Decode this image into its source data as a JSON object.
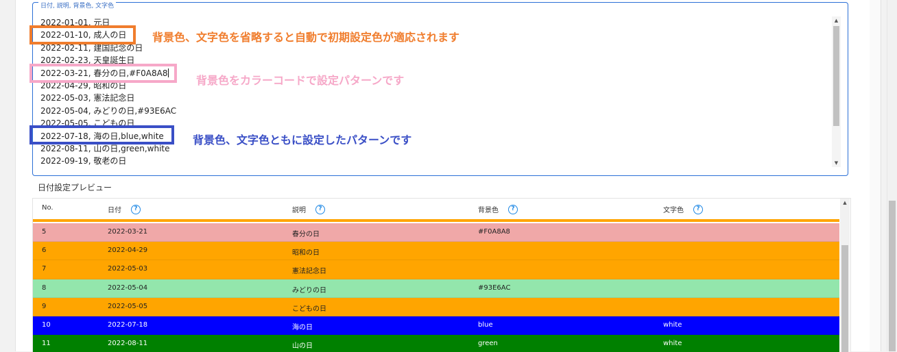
{
  "date_box": {
    "legend": "日付, 説明, 背景色, 文字色",
    "lines": [
      "2022-01-01, 元日",
      "2022-01-10, 成人の日",
      "2022-02-11, 建国記念の日",
      "2022-02-23, 天皇誕生日",
      "2022-03-21, 春分の日,#F0A8A8",
      "2022-04-29, 昭和の日",
      "2022-05-03, 憲法記念日",
      "2022-05-04, みどりの日,#93E6AC",
      "2022-05-05, こどもの日",
      "2022-07-18, 海の日,blue,white",
      "2022-08-11, 山の日,green,white",
      "2022-09-19, 敬老の日"
    ]
  },
  "annotations": {
    "orange": "背景色、文字色を省略すると自動で初期設定色が適応されます",
    "pink": "背景色をカラーコードで設定パターンです",
    "blue": "背景色、文字色ともに設定したパターンです"
  },
  "preview": {
    "title": "日付設定プレビュー",
    "headers": [
      "No.",
      "日付",
      "説明",
      "背景色",
      "文字色"
    ],
    "help_glyph": "?",
    "rows": [
      {
        "no": "5",
        "date": "2022-03-21",
        "desc": "春分の日",
        "bg": "#F0A8A8",
        "fg": "",
        "bg_color": "#f0a8a8",
        "fg_color": "#222222"
      },
      {
        "no": "6",
        "date": "2022-04-29",
        "desc": "昭和の日",
        "bg": "",
        "fg": "",
        "bg_color": "#ffa500",
        "fg_color": "#222222"
      },
      {
        "no": "7",
        "date": "2022-05-03",
        "desc": "憲法記念日",
        "bg": "",
        "fg": "",
        "bg_color": "#ffa500",
        "fg_color": "#222222"
      },
      {
        "no": "8",
        "date": "2022-05-04",
        "desc": "みどりの日",
        "bg": "#93E6AC",
        "fg": "",
        "bg_color": "#93e6ac",
        "fg_color": "#222222"
      },
      {
        "no": "9",
        "date": "2022-05-05",
        "desc": "こどもの日",
        "bg": "",
        "fg": "",
        "bg_color": "#ffa500",
        "fg_color": "#222222"
      },
      {
        "no": "10",
        "date": "2022-07-18",
        "desc": "海の日",
        "bg": "blue",
        "fg": "white",
        "bg_color": "#0000ff",
        "fg_color": "#ffffff"
      },
      {
        "no": "11",
        "date": "2022-08-11",
        "desc": "山の日",
        "bg": "green",
        "fg": "white",
        "bg_color": "#008000",
        "fg_color": "#ffffff"
      }
    ]
  }
}
